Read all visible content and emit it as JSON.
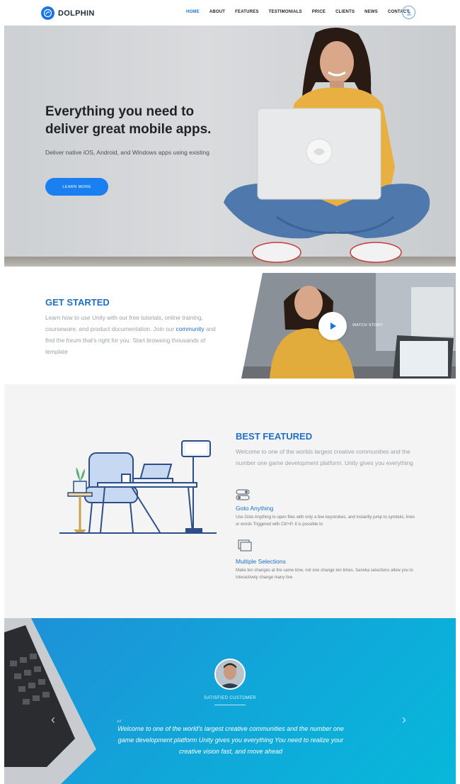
{
  "header": {
    "brand": "DOLPHIN",
    "nav": [
      "HOME",
      "ABOUT",
      "FEATURES",
      "TESTIMONIALS",
      "PRICE",
      "CLIENTS",
      "NEWS",
      "CONTACT"
    ],
    "active_index": 0,
    "brand_color": "#1a73e8"
  },
  "hero": {
    "title_line1": "Everything you need to",
    "title_line2": "deliver great mobile apps.",
    "subtitle": "Deliver native iOS, Android, and Windows apps using existing",
    "button": "LEARN MORE",
    "button_color": "#1a7ff0"
  },
  "get_started": {
    "title_bold": "GET",
    "title_rest": "STARTED",
    "text_before_link": "Learn how to use Unity with our free tutorials, online training, courseware, and product documentation. Join our",
    "link": "community",
    "text_after_link": "and find the forum that's right for you. Start browsing thousands of template",
    "watch_label": "WATCH STORY"
  },
  "featured": {
    "title_bold": "BEST",
    "title_rest": "FEATURED",
    "text": "Welcome to one of the worlds largest creative communities and the number one game development platform. Unity gives you everything",
    "items": [
      {
        "icon": "toggle-icon",
        "title": "Goto Anything",
        "desc": "Use Goto Anything to open files with only a few keystrokes, and instantly jump to symbols, lines or words Triggered with Ctrl+P. It is possible to"
      },
      {
        "icon": "windows-icon",
        "title": "Multiple Selections",
        "desc": "Make ten changes at the same time, not one change ten times. Sarwka selections allow you to interactively change many line"
      }
    ]
  },
  "testimonial": {
    "label": "SATISFIED CUSTOMER",
    "quote": "Welcome to one of the world's largest creative communities and the number one game development platform Unity gives you everything You need to realize your creative vision fast, and move ahead",
    "gradient_start": "#1f8fd8",
    "gradient_end": "#07b8da"
  }
}
